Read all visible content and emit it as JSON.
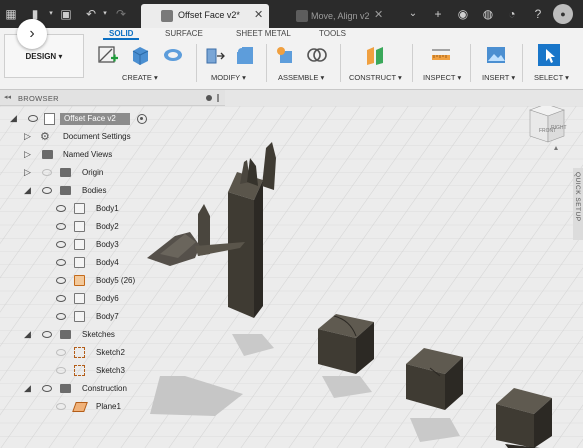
{
  "tabs": {
    "active": {
      "label": "Offset Face v2*",
      "close": "✕"
    },
    "inactive": {
      "label": "Move, Align v2",
      "close": "✕"
    }
  },
  "toolbar": {
    "back_glyph": "›",
    "workspace": "DESIGN ▾",
    "ribbon_tabs": [
      "SOLID",
      "SURFACE",
      "SHEET METAL",
      "TOOLS"
    ],
    "groups": [
      "CREATE ▾",
      "MODIFY ▾",
      "ASSEMBLE ▾",
      "CONSTRUCT ▾",
      "INSPECT ▾",
      "INSERT ▾",
      "SELECT ▾"
    ]
  },
  "browser": {
    "header": "BROWSER",
    "root": "Offset Face v2",
    "items": {
      "document_settings": "Document Settings",
      "named_views": "Named Views",
      "origin": "Origin",
      "bodies": "Bodies",
      "body1": "Body1",
      "body2": "Body2",
      "body3": "Body3",
      "body4": "Body4",
      "body5": "Body5 (26)",
      "body6": "Body6",
      "body7": "Body7",
      "sketches": "Sketches",
      "sketch2": "Sketch2",
      "sketch3": "Sketch3",
      "construction": "Construction",
      "plane1": "Plane1"
    }
  },
  "viewcube": {
    "face_label": "RIGHT",
    "front_label": "FRONT"
  },
  "quick_setup": "QUICK SETUP",
  "colors": {
    "accent": "#0b6fc2",
    "body": "#3f3b33",
    "highlight": "#8c8c8c"
  }
}
